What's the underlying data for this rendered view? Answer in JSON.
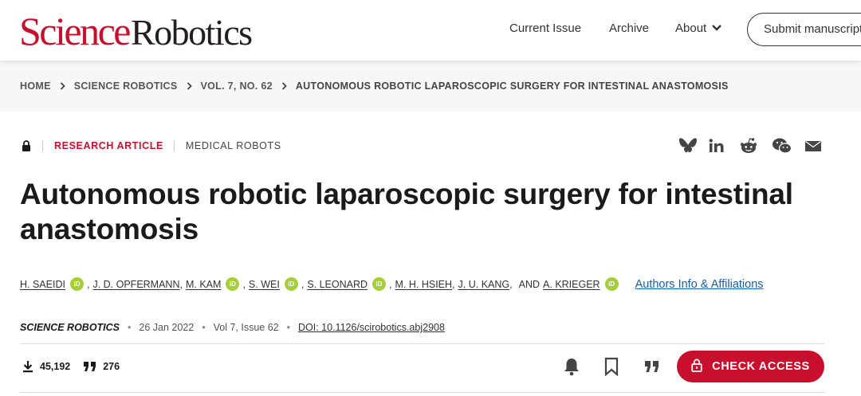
{
  "brand": {
    "science": "Science",
    "robotics": "Robotics"
  },
  "nav": {
    "current_issue": "Current Issue",
    "archive": "Archive",
    "about": "About",
    "submit": "Submit manuscript"
  },
  "breadcrumb": [
    "HOME",
    "SCIENCE ROBOTICS",
    "VOL. 7, NO. 62",
    "AUTONOMOUS ROBOTIC LAPAROSCOPIC SURGERY FOR INTESTINAL ANASTOMOSIS"
  ],
  "article": {
    "type": "RESEARCH ARTICLE",
    "subject": "MEDICAL ROBOTS",
    "title": "Autonomous robotic laparoscopic surgery for intestinal anastomosis",
    "authors": [
      "H. SAEIDI",
      "J. D. OPFERMANN",
      "M. KAM",
      "S. WEI",
      "S. LEONARD",
      "M. H. HSIEH",
      "J. U. KANG",
      "A. KRIEGER"
    ],
    "and_word": "AND",
    "orcid_label": "iD",
    "affiliations_link": "Authors Info & Affiliations",
    "journal": "SCIENCE ROBOTICS",
    "date": "26 Jan 2022",
    "volume_issue": "Vol 7, Issue 62",
    "doi": "DOI: 10.1126/scirobotics.abj2908",
    "downloads": "45,192",
    "citations": "276",
    "check_access": "CHECK ACCESS"
  },
  "colors": {
    "brand_red": "#c8102e",
    "orcid_green": "#a6ce39",
    "link_blue": "#1a5ca8"
  },
  "icons": [
    "lock-icon",
    "bluesky-icon",
    "linkedin-icon",
    "reddit-icon",
    "wechat-icon",
    "email-icon",
    "download-icon",
    "quote-icon",
    "bell-icon",
    "bookmark-icon",
    "cite-icon",
    "chevron-down-icon",
    "chevron-right-icon"
  ]
}
